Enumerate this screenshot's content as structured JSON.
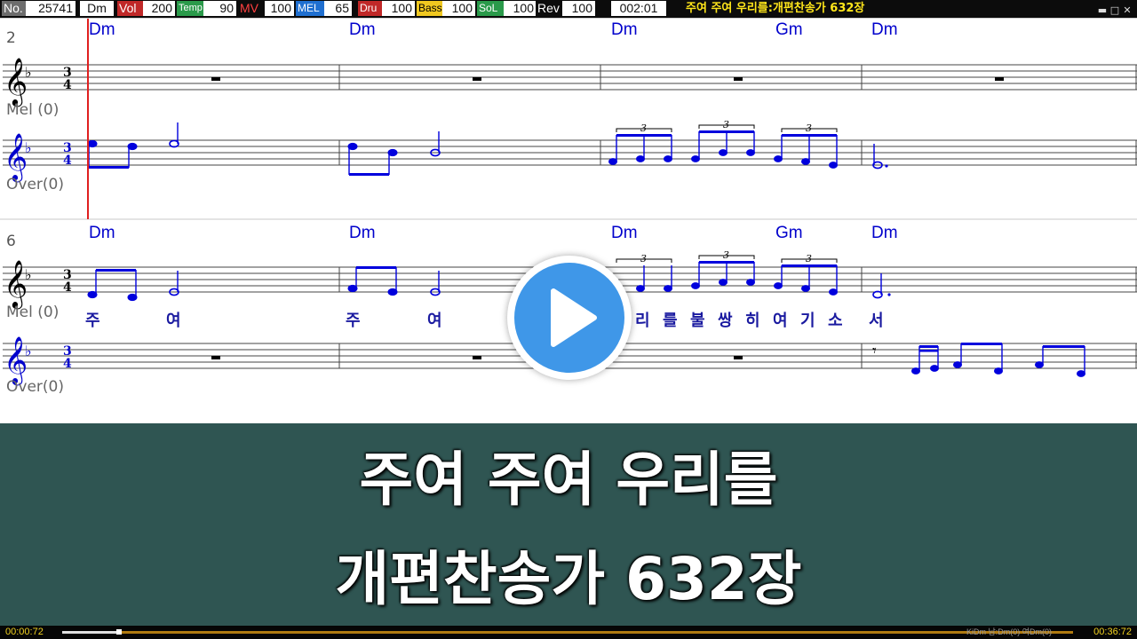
{
  "colors": {
    "accent": "#0000cc",
    "playhead": "#e02020",
    "banner": "#2f5552",
    "title_yellow": "#ffe61a",
    "play_blue": "#3f97e8"
  },
  "status_bar": {
    "fields": [
      {
        "label": "No.",
        "value": "25741",
        "label_color": "#ffffff",
        "label_bg": "#6d6d6d"
      },
      {
        "label": "",
        "value": "Dm",
        "label_color": "#ffffff",
        "label_bg": "#0c0c0c"
      },
      {
        "label": "Vol",
        "value": "200",
        "label_color": "#ffffff",
        "label_bg": "#c02828"
      },
      {
        "label": "Temp",
        "value": "90",
        "label_color": "#ffffff",
        "label_bg": "#2a9a4a"
      },
      {
        "label": "MV",
        "value": "100",
        "label_color": "#ff4040",
        "label_bg": "#0c0c0c"
      },
      {
        "label": "MEL",
        "value": "65",
        "label_color": "#ffffff",
        "label_bg": "#1f6fd0"
      },
      {
        "label": "Dru",
        "value": "100",
        "label_color": "#ffffff",
        "label_bg": "#c02828"
      },
      {
        "label": "Bass",
        "value": "100",
        "label_color": "#000000",
        "label_bg": "#f0c820"
      },
      {
        "label": "SoL",
        "value": "100",
        "label_color": "#ffffff",
        "label_bg": "#2a9a4a"
      },
      {
        "label": "Rev",
        "value": "100",
        "label_color": "#ffffff",
        "label_bg": "#0c0c0c"
      }
    ],
    "elapsed": "002:01",
    "song_title": "주여 주여 우리를:개편찬송가 632장",
    "window_controls": [
      "minimize-icon",
      "restore-icon",
      "close-icon"
    ]
  },
  "score": {
    "key_signature": "F/Dm (1 flat)",
    "time_signature": {
      "top": "3",
      "bottom": "4"
    },
    "systems": [
      {
        "measure_number": "2",
        "chords": [
          "Dm",
          "Dm",
          "Dm",
          "Gm",
          "Dm"
        ],
        "melody_label": "Mel (0)",
        "over_label": "Over(0)",
        "lyrics": []
      },
      {
        "measure_number": "6",
        "chords": [
          "Dm",
          "Dm",
          "Dm",
          "Gm",
          "Dm"
        ],
        "melody_label": "Mel (0)",
        "over_label": "Over(0)",
        "lyrics": [
          "주",
          "여",
          "주",
          "여",
          "리",
          "를",
          "불",
          "쌍",
          "히",
          "여",
          "기",
          "소",
          "서"
        ]
      }
    ],
    "triplet_mark": "3"
  },
  "banner": {
    "line1": "주여 주여 우리를",
    "line2": "개편찬송가 632장"
  },
  "progress": {
    "elapsed": "00:00:72",
    "total": "00:36:72",
    "fraction": 0.056,
    "chord_info": "KiDm 남:Dm(0) 여Dm(0)"
  }
}
